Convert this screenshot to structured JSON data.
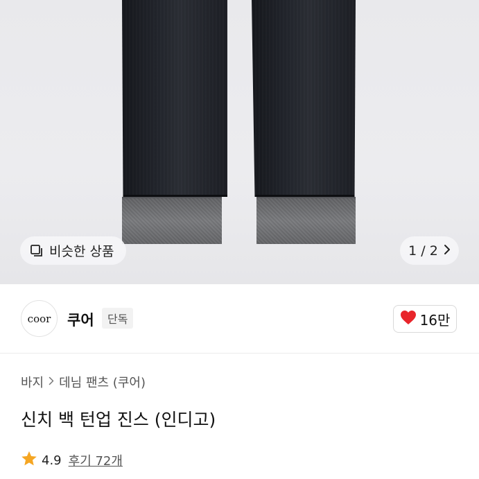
{
  "gallery": {
    "similar_label": "비슷한 상품",
    "current_page": "1",
    "page_separator": "/",
    "total_pages": "2"
  },
  "brand": {
    "logo_text": "coor",
    "name": "쿠어",
    "badge": "단독"
  },
  "like": {
    "count": "16만",
    "icon": "heart-icon",
    "color": "#e8252b"
  },
  "breadcrumb": {
    "items": [
      "바지",
      "데님 팬츠 (쿠어)"
    ]
  },
  "product": {
    "title": "신치 백 턴업 진스 (인디고)"
  },
  "rating": {
    "score": "4.9",
    "review_link": "후기 72개",
    "star_color": "#f5a623"
  }
}
